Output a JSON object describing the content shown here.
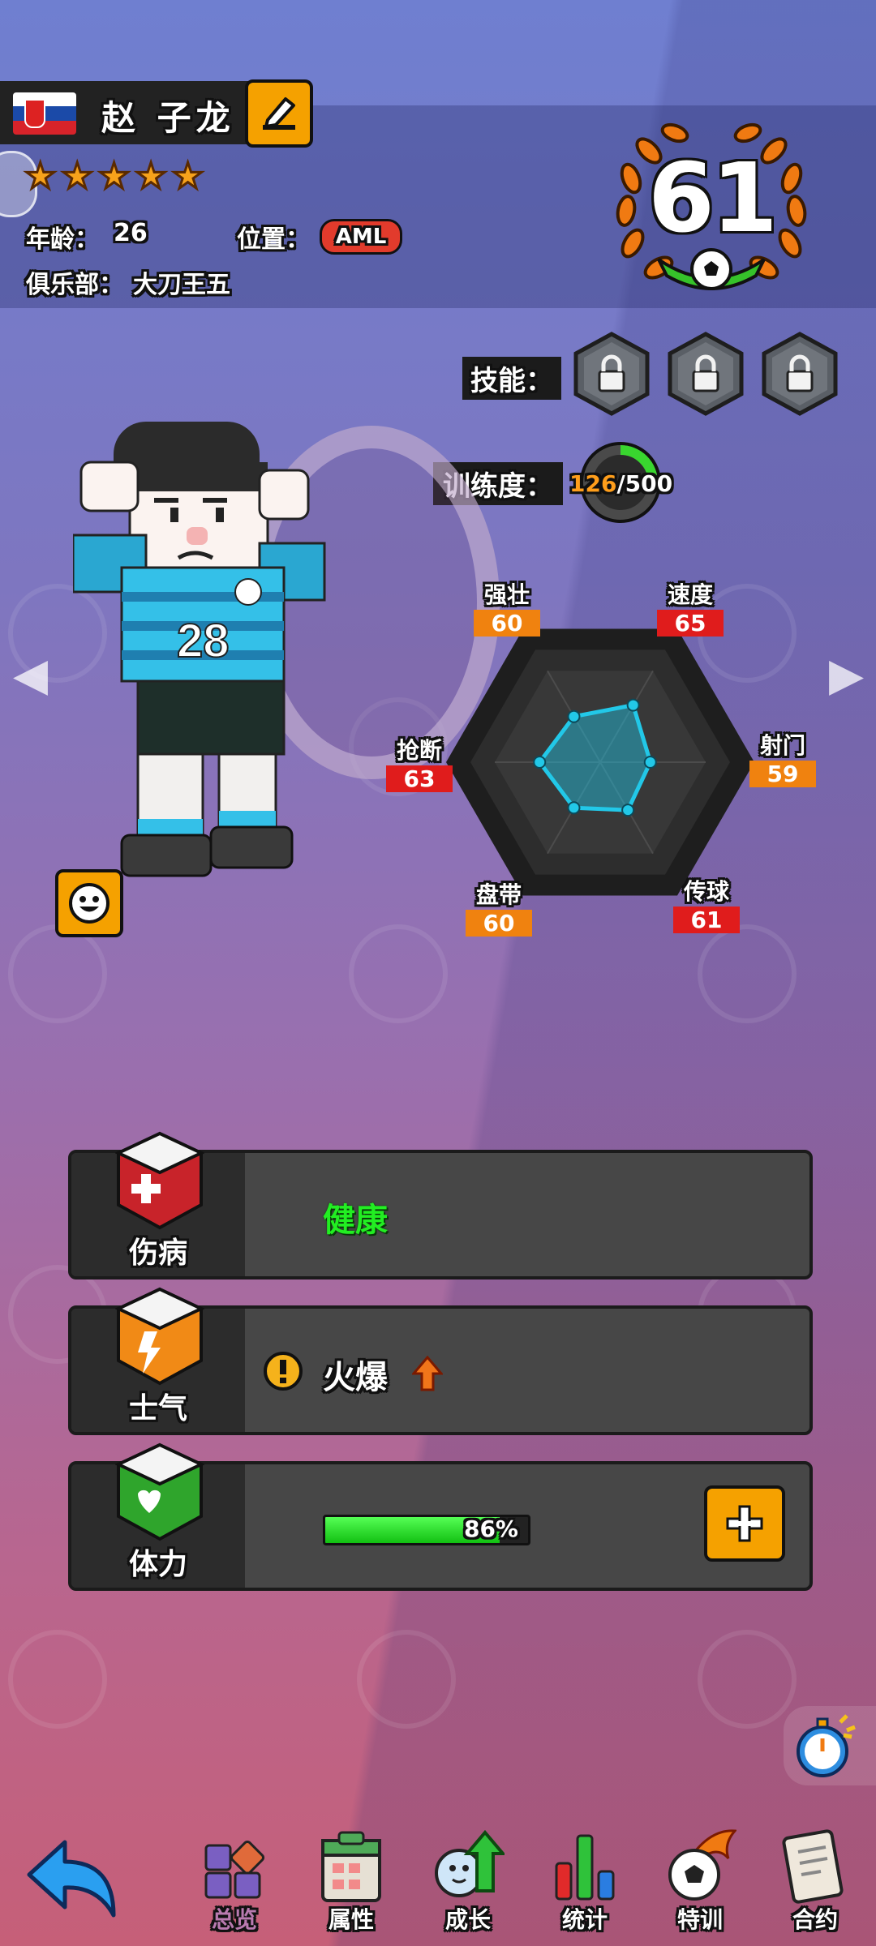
{
  "player": {
    "name": "赵 子龙",
    "stars": 5,
    "age_label": "年龄：",
    "age": "26",
    "position_label": "位置：",
    "position": "AML",
    "club_label": "俱乐部：",
    "club": "大刀王五",
    "rating": "61",
    "jersey_number": "28",
    "flag": "slovakia-flag"
  },
  "skills": {
    "label": "技能：",
    "slots": [
      "locked",
      "locked",
      "locked"
    ]
  },
  "training": {
    "label": "训练度：",
    "current": "126",
    "separator": "/500",
    "fraction": 0.252
  },
  "attributes": [
    {
      "name": "强壮",
      "value": "60",
      "color": "#f0820f"
    },
    {
      "name": "速度",
      "value": "65",
      "color": "#e01c1c"
    },
    {
      "name": "射门",
      "value": "59",
      "color": "#f0820f"
    },
    {
      "name": "传球",
      "value": "61",
      "color": "#e01c1c"
    },
    {
      "name": "盘带",
      "value": "60",
      "color": "#f0820f"
    },
    {
      "name": "抢断",
      "value": "63",
      "color": "#e01c1c"
    }
  ],
  "status": {
    "injury_label": "伤病",
    "injury_value": "健康",
    "morale_label": "士气",
    "morale_value": "火爆",
    "stamina_label": "体力",
    "stamina_value": "86%",
    "stamina_fraction": 0.86
  },
  "nav": {
    "items": [
      "总览",
      "属性",
      "成长",
      "统计",
      "特训",
      "合约"
    ],
    "active": "总览"
  },
  "colors": {
    "accent_orange": "#f5a100",
    "health_green": "#22ee22",
    "radar_cyan": "#22c8e8"
  }
}
